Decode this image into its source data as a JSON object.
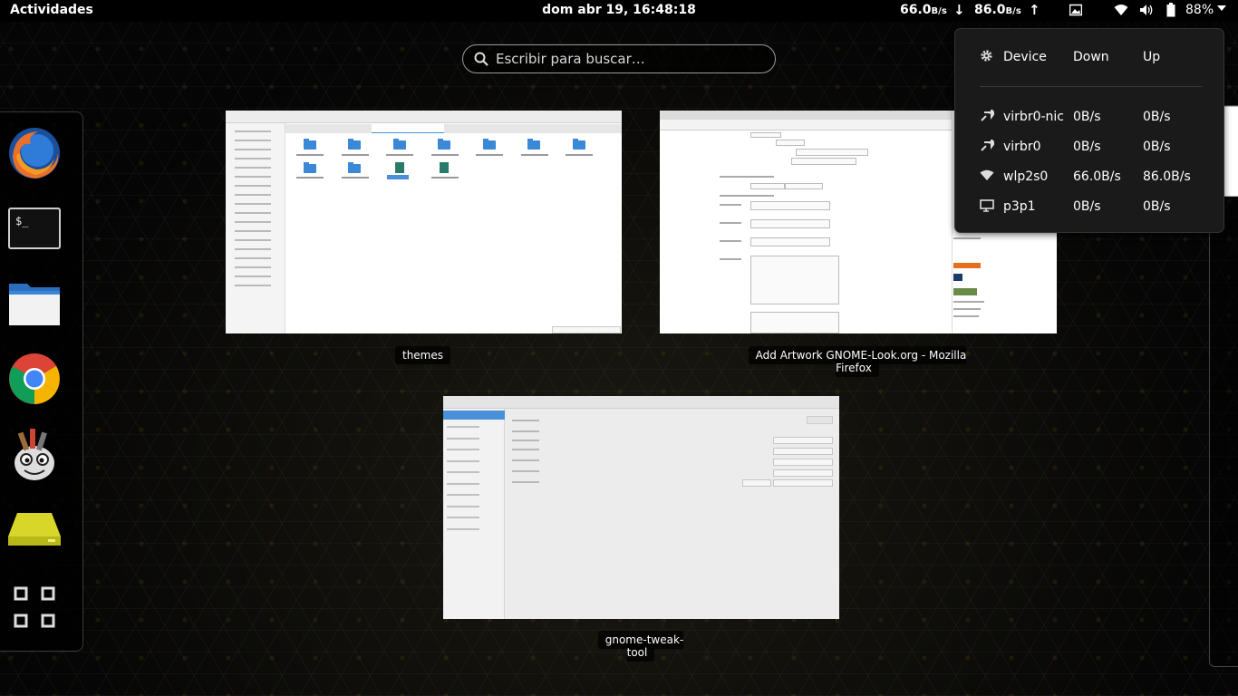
{
  "topbar": {
    "activities": "Actividades",
    "clock": "dom abr 19, 16:48:18",
    "net_down_value": "66.0",
    "net_down_unit": "B/s",
    "net_up_value": "86.0",
    "net_up_unit": "B/s",
    "battery_percent": "88%"
  },
  "search": {
    "placeholder": "Escribir para buscar…"
  },
  "dash": {
    "items": [
      "firefox-icon",
      "terminal-icon",
      "files-icon",
      "chrome-icon",
      "gimp-icon",
      "disk-icon",
      "show-applications-icon"
    ],
    "terminal_prompt": "$_"
  },
  "windows": {
    "nautilus_title": "themes",
    "firefox_title": "Add  Artwork GNOME-Look.org - Mozilla Firefox",
    "tweak_title": "gnome-tweak-tool"
  },
  "network_popup": {
    "headers": {
      "device": "Device",
      "down": "Down",
      "up": "Up"
    },
    "rows": [
      {
        "icon": "wired-icon",
        "device": "virbr0-nic",
        "down": "0B/s",
        "up": "0B/s"
      },
      {
        "icon": "wired-icon",
        "device": "virbr0",
        "down": "0B/s",
        "up": "0B/s"
      },
      {
        "icon": "wifi-icon",
        "device": "wlp2s0",
        "down": "66.0B/s",
        "up": "86.0B/s"
      },
      {
        "icon": "monitor-icon",
        "device": "p3p1",
        "down": "0B/s",
        "up": "0B/s"
      }
    ]
  },
  "colors": {
    "accent": "#4a90d9",
    "folder": "#3a88d6",
    "panel": "#000000"
  }
}
